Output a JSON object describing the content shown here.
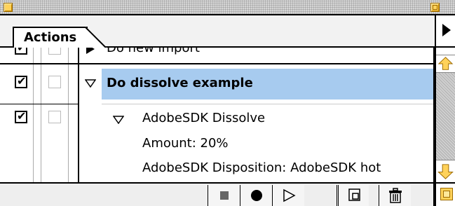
{
  "window": {
    "tab_label": "Actions"
  },
  "actions": [
    {
      "label": "Do new import",
      "checked": true,
      "expanded": false,
      "partially_visible": true
    },
    {
      "label": "Do dissolve example",
      "checked": true,
      "expanded": true,
      "selected": true,
      "steps": [
        {
          "label": "AdobeSDK Dissolve",
          "expanded": true,
          "params": [
            {
              "label": "Amount: 20%"
            },
            {
              "label": "AdobeSDK Disposition:  AdobeSDK hot"
            }
          ]
        }
      ]
    }
  ],
  "toolbar": {
    "buttons": [
      {
        "name": "stop",
        "icon": "stop-icon"
      },
      {
        "name": "record",
        "icon": "record-icon"
      },
      {
        "name": "play",
        "icon": "play-icon"
      },
      {
        "name": "new-action",
        "icon": "new-action-icon"
      },
      {
        "name": "delete",
        "icon": "trash-icon"
      }
    ]
  },
  "colors": {
    "selection": "#a7cbef",
    "accent": "#ffd25a"
  }
}
